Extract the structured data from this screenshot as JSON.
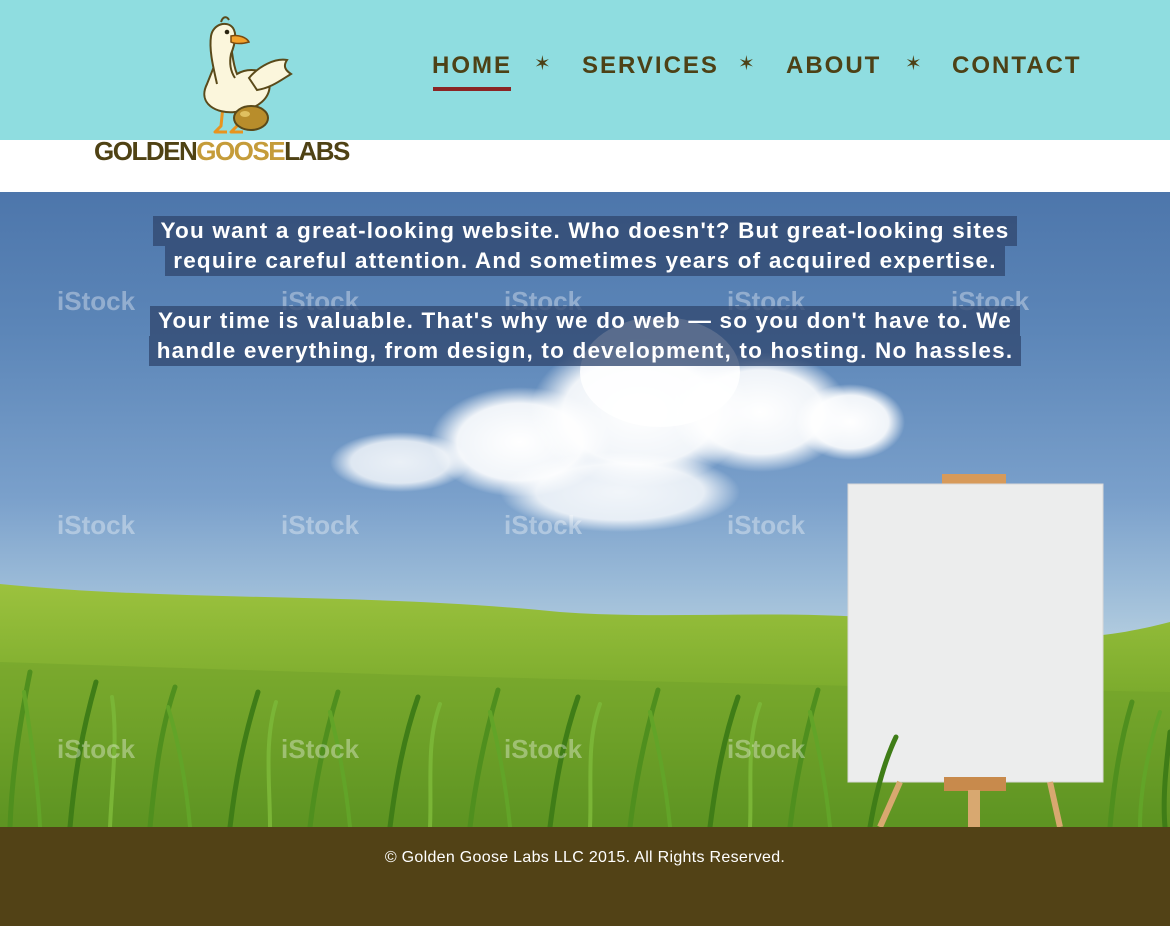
{
  "brand": {
    "word1": "GOLDEN",
    "word2": "GOOSE",
    "word3": "LABS",
    "mascot_icon": "goose-icon"
  },
  "nav": {
    "items": [
      {
        "label": "HOME",
        "active": true
      },
      {
        "label": "SERVICES",
        "active": false
      },
      {
        "label": "ABOUT",
        "active": false
      },
      {
        "label": "CONTACT",
        "active": false
      }
    ],
    "separator_icon": "star-icon"
  },
  "hero": {
    "paragraph1": [
      "You want a great-looking website. Who doesn't? But great-looking sites",
      "require careful attention. And sometimes years of acquired expertise."
    ],
    "paragraph2": [
      "Your time is valuable. That's why we do web — so you don't have to. We",
      "handle everything, from design, to development, to hosting. No hassles."
    ]
  },
  "footer": {
    "copyright": "© Golden Goose Labs LLC 2015. All Rights Reserved."
  },
  "colors": {
    "header_bg": "#8fdde0",
    "nav_text": "#4d4116",
    "active_underline": "#8b2525",
    "footer_bg": "#524216",
    "brand_gold": "#c59c3a",
    "brand_brown": "#4f4214",
    "text_box": "#314870"
  }
}
